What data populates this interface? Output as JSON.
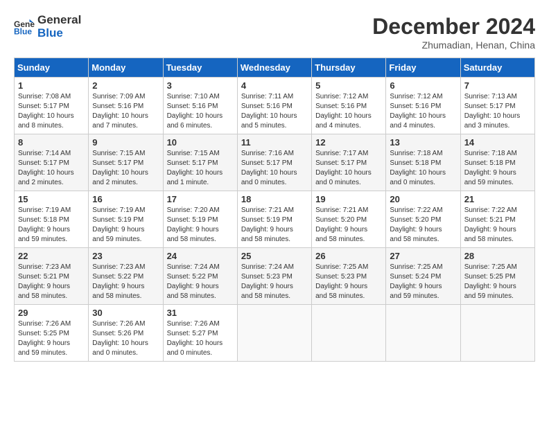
{
  "header": {
    "logo_line1": "General",
    "logo_line2": "Blue",
    "month": "December 2024",
    "location": "Zhumadian, Henan, China"
  },
  "weekdays": [
    "Sunday",
    "Monday",
    "Tuesday",
    "Wednesday",
    "Thursday",
    "Friday",
    "Saturday"
  ],
  "weeks": [
    [
      {
        "day": "1",
        "info": "Sunrise: 7:08 AM\nSunset: 5:17 PM\nDaylight: 10 hours\nand 8 minutes."
      },
      {
        "day": "2",
        "info": "Sunrise: 7:09 AM\nSunset: 5:16 PM\nDaylight: 10 hours\nand 7 minutes."
      },
      {
        "day": "3",
        "info": "Sunrise: 7:10 AM\nSunset: 5:16 PM\nDaylight: 10 hours\nand 6 minutes."
      },
      {
        "day": "4",
        "info": "Sunrise: 7:11 AM\nSunset: 5:16 PM\nDaylight: 10 hours\nand 5 minutes."
      },
      {
        "day": "5",
        "info": "Sunrise: 7:12 AM\nSunset: 5:16 PM\nDaylight: 10 hours\nand 4 minutes."
      },
      {
        "day": "6",
        "info": "Sunrise: 7:12 AM\nSunset: 5:16 PM\nDaylight: 10 hours\nand 4 minutes."
      },
      {
        "day": "7",
        "info": "Sunrise: 7:13 AM\nSunset: 5:17 PM\nDaylight: 10 hours\nand 3 minutes."
      }
    ],
    [
      {
        "day": "8",
        "info": "Sunrise: 7:14 AM\nSunset: 5:17 PM\nDaylight: 10 hours\nand 2 minutes."
      },
      {
        "day": "9",
        "info": "Sunrise: 7:15 AM\nSunset: 5:17 PM\nDaylight: 10 hours\nand 2 minutes."
      },
      {
        "day": "10",
        "info": "Sunrise: 7:15 AM\nSunset: 5:17 PM\nDaylight: 10 hours\nand 1 minute."
      },
      {
        "day": "11",
        "info": "Sunrise: 7:16 AM\nSunset: 5:17 PM\nDaylight: 10 hours\nand 0 minutes."
      },
      {
        "day": "12",
        "info": "Sunrise: 7:17 AM\nSunset: 5:17 PM\nDaylight: 10 hours\nand 0 minutes."
      },
      {
        "day": "13",
        "info": "Sunrise: 7:18 AM\nSunset: 5:18 PM\nDaylight: 10 hours\nand 0 minutes."
      },
      {
        "day": "14",
        "info": "Sunrise: 7:18 AM\nSunset: 5:18 PM\nDaylight: 9 hours\nand 59 minutes."
      }
    ],
    [
      {
        "day": "15",
        "info": "Sunrise: 7:19 AM\nSunset: 5:18 PM\nDaylight: 9 hours\nand 59 minutes."
      },
      {
        "day": "16",
        "info": "Sunrise: 7:19 AM\nSunset: 5:19 PM\nDaylight: 9 hours\nand 59 minutes."
      },
      {
        "day": "17",
        "info": "Sunrise: 7:20 AM\nSunset: 5:19 PM\nDaylight: 9 hours\nand 58 minutes."
      },
      {
        "day": "18",
        "info": "Sunrise: 7:21 AM\nSunset: 5:19 PM\nDaylight: 9 hours\nand 58 minutes."
      },
      {
        "day": "19",
        "info": "Sunrise: 7:21 AM\nSunset: 5:20 PM\nDaylight: 9 hours\nand 58 minutes."
      },
      {
        "day": "20",
        "info": "Sunrise: 7:22 AM\nSunset: 5:20 PM\nDaylight: 9 hours\nand 58 minutes."
      },
      {
        "day": "21",
        "info": "Sunrise: 7:22 AM\nSunset: 5:21 PM\nDaylight: 9 hours\nand 58 minutes."
      }
    ],
    [
      {
        "day": "22",
        "info": "Sunrise: 7:23 AM\nSunset: 5:21 PM\nDaylight: 9 hours\nand 58 minutes."
      },
      {
        "day": "23",
        "info": "Sunrise: 7:23 AM\nSunset: 5:22 PM\nDaylight: 9 hours\nand 58 minutes."
      },
      {
        "day": "24",
        "info": "Sunrise: 7:24 AM\nSunset: 5:22 PM\nDaylight: 9 hours\nand 58 minutes."
      },
      {
        "day": "25",
        "info": "Sunrise: 7:24 AM\nSunset: 5:23 PM\nDaylight: 9 hours\nand 58 minutes."
      },
      {
        "day": "26",
        "info": "Sunrise: 7:25 AM\nSunset: 5:23 PM\nDaylight: 9 hours\nand 58 minutes."
      },
      {
        "day": "27",
        "info": "Sunrise: 7:25 AM\nSunset: 5:24 PM\nDaylight: 9 hours\nand 59 minutes."
      },
      {
        "day": "28",
        "info": "Sunrise: 7:25 AM\nSunset: 5:25 PM\nDaylight: 9 hours\nand 59 minutes."
      }
    ],
    [
      {
        "day": "29",
        "info": "Sunrise: 7:26 AM\nSunset: 5:25 PM\nDaylight: 9 hours\nand 59 minutes."
      },
      {
        "day": "30",
        "info": "Sunrise: 7:26 AM\nSunset: 5:26 PM\nDaylight: 10 hours\nand 0 minutes."
      },
      {
        "day": "31",
        "info": "Sunrise: 7:26 AM\nSunset: 5:27 PM\nDaylight: 10 hours\nand 0 minutes."
      },
      null,
      null,
      null,
      null
    ]
  ]
}
